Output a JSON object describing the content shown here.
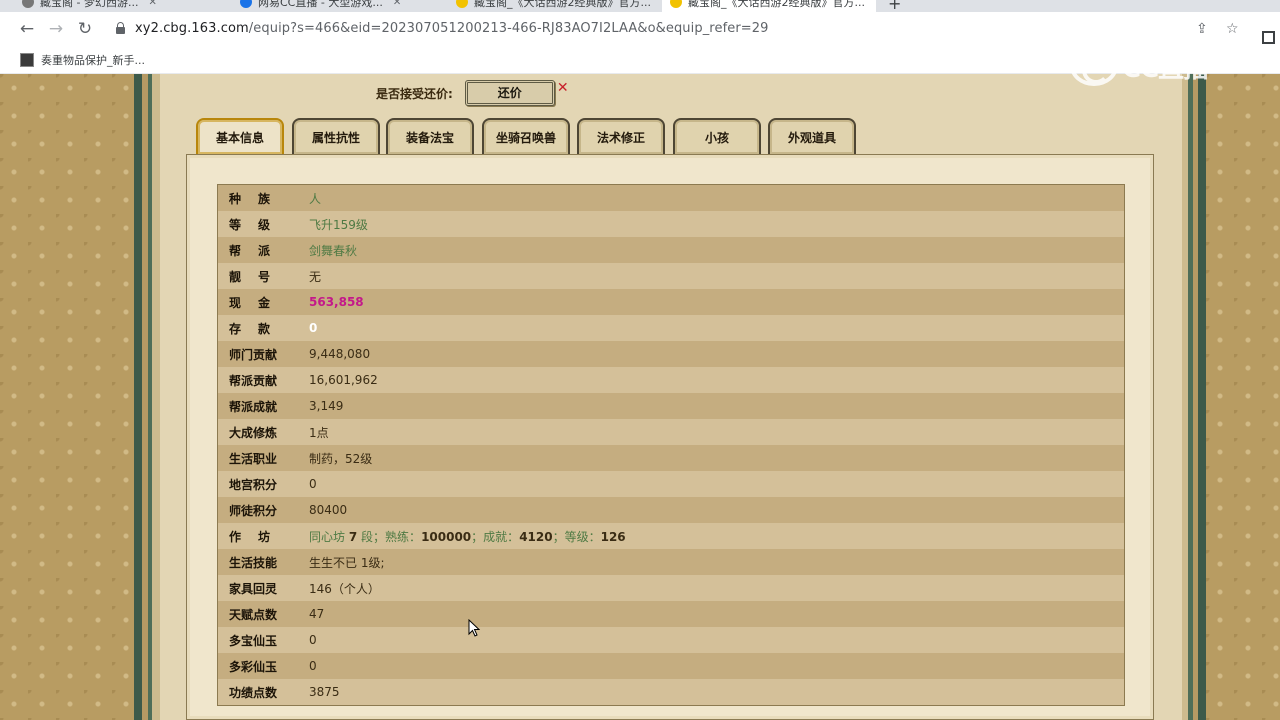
{
  "browser": {
    "tabs": [
      {
        "title": "藏宝阁 - 梦幻西游..."
      },
      {
        "title": "网易CC直播 - 大型游戏..."
      },
      {
        "title": "藏宝阁_《大话西游2经典版》官方..."
      },
      {
        "title": "藏宝阁_《大话西游2经典版》官方..."
      }
    ],
    "url_host": "xy2.cbg.163.com",
    "url_rest": "/equip?s=466&eid=202307051200213-466-RJ83AO7I2LAA&o&equip_refer=29",
    "bookmark": "奏重物品保护_新手..."
  },
  "watermark": {
    "text": "CC直播"
  },
  "offer": {
    "label": "是否接受还价:",
    "button": "还价"
  },
  "tabs": [
    "基本信息",
    "属性抗性",
    "装备法宝",
    "坐骑召唤兽",
    "法术修正",
    "小孩",
    "外观道具"
  ],
  "rows": [
    {
      "label": "种族",
      "value": "人",
      "style": "green"
    },
    {
      "label": "等级",
      "value": "飞升159级",
      "style": "green"
    },
    {
      "label": "帮派",
      "value": "剑舞春秋",
      "style": "green"
    },
    {
      "label": "靓号",
      "value": "无",
      "style": "dark"
    },
    {
      "label": "现金",
      "value": "563,858",
      "style": "magenta"
    },
    {
      "label": "存款",
      "value": "0",
      "style": "white"
    },
    {
      "label": "师门贡献",
      "value": "9,448,080",
      "style": "dark"
    },
    {
      "label": "帮派贡献",
      "value": "16,601,962",
      "style": "dark"
    },
    {
      "label": "帮派成就",
      "value": "3,149",
      "style": "dark"
    },
    {
      "label": "大成修炼",
      "value": "1点",
      "style": "dark"
    },
    {
      "label": "生活职业",
      "value": "制药，52级",
      "style": "dark"
    },
    {
      "label": "地宫积分",
      "value": "0",
      "style": "dark"
    },
    {
      "label": "师徒积分",
      "value": "80400",
      "style": "dark"
    },
    {
      "label": "作坊",
      "value": "",
      "style": "mixed"
    },
    {
      "label": "生活技能",
      "value": "生生不已 1级;",
      "style": "dark"
    },
    {
      "label": "家具回灵",
      "value": "146（个人）",
      "style": "dark"
    },
    {
      "label": "天赋点数",
      "value": "47",
      "style": "dark"
    },
    {
      "label": "多宝仙玉",
      "value": "0",
      "style": "dark"
    },
    {
      "label": "多彩仙玉",
      "value": "0",
      "style": "dark"
    },
    {
      "label": "功绩点数",
      "value": "3875",
      "style": "dark"
    }
  ],
  "workshop": {
    "name": "同心坊",
    "level": "7",
    "level_unit": "段；",
    "skill_label": "熟练：",
    "skill": "100000",
    "ach_label": "；成就：",
    "ach": "4120",
    "grade_label": "；等级：",
    "grade": "126"
  },
  "colors": {
    "green": "#4f7a44",
    "magenta": "#c4188a",
    "row_odd": "#c5ad80",
    "row_even": "#d4c099"
  }
}
